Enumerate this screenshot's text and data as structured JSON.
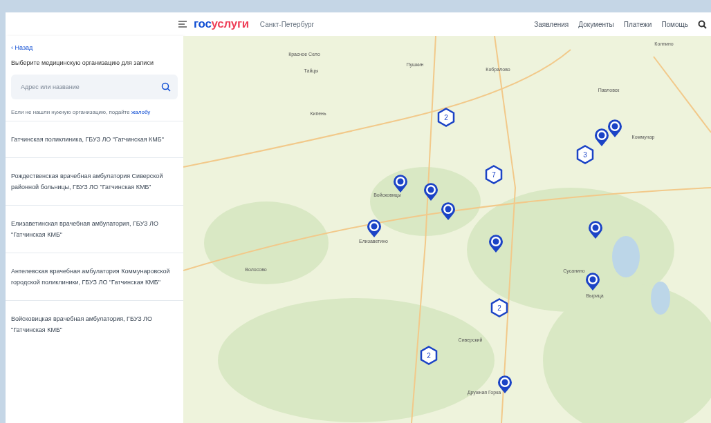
{
  "header": {
    "logo_first": "гос",
    "logo_second": "услуги",
    "region": "Санкт-Петербург",
    "nav": [
      "Заявления",
      "Документы",
      "Платежи",
      "Помощь"
    ]
  },
  "sidebar": {
    "back": "‹ Назад",
    "prompt": "Выберите медицинскую организацию для записи",
    "search": {
      "placeholder": "Адрес или название"
    },
    "hint": "Если не нашли нужную организацию, подайте",
    "hint_link": "жалобу",
    "organizations": [
      {
        "name": "Гатчинская поликлиника, ГБУЗ ЛО \"Гатчинская КМБ\""
      },
      {
        "name": "Рождественская врачебная амбулатория Сиверской районной больницы, ГБУЗ ЛО \"Гатчинская КМБ\""
      },
      {
        "name": "Елизаветинская врачебная амбулатория, ГБУЗ ЛО \"Гатчинская КМБ\""
      },
      {
        "name": "Антелевская врачебная амбулатория Коммунаровской городской поликлиники, ГБУЗ ЛО \"Гатчинская КМБ\""
      },
      {
        "name": "Войсковицкая врачебная амбулатория, ГБУЗ ЛО \"Гатчинская КМБ\""
      }
    ]
  },
  "map": {
    "places": [
      "Колпино",
      "Красное Село",
      "Пушкин",
      "Кобралово",
      "Тайцы",
      "Павловск",
      "Кипень",
      "Коммунар",
      "Войсковицы",
      "Елизаветино",
      "Волосово",
      "Сусанино",
      "Вырица",
      "Сиверский",
      "Дружная Горка"
    ],
    "markers": [
      {
        "kind": "cluster",
        "count": "2"
      },
      {
        "kind": "cluster",
        "count": "7"
      },
      {
        "kind": "cluster",
        "count": "3"
      },
      {
        "kind": "cluster",
        "count": "2"
      },
      {
        "kind": "cluster",
        "count": "2"
      },
      {
        "kind": "pin"
      },
      {
        "kind": "pin"
      },
      {
        "kind": "pin"
      },
      {
        "kind": "pin"
      },
      {
        "kind": "pin"
      },
      {
        "kind": "pin"
      },
      {
        "kind": "pin"
      },
      {
        "kind": "pin"
      },
      {
        "kind": "pin"
      },
      {
        "kind": "pin"
      }
    ]
  }
}
